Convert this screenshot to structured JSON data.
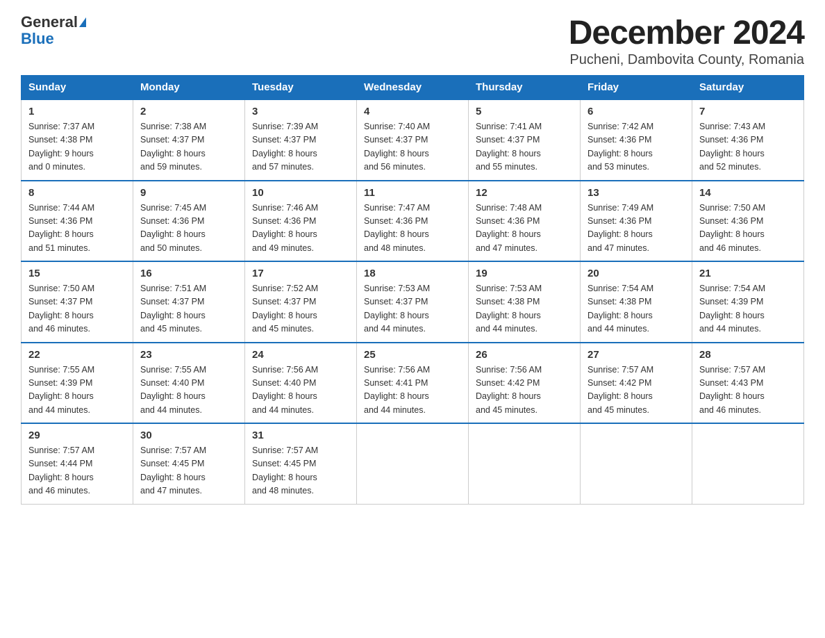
{
  "header": {
    "logo_general": "General",
    "logo_blue": "Blue",
    "title": "December 2024",
    "subtitle": "Pucheni, Dambovita County, Romania"
  },
  "days_of_week": [
    "Sunday",
    "Monday",
    "Tuesday",
    "Wednesday",
    "Thursday",
    "Friday",
    "Saturday"
  ],
  "weeks": [
    [
      {
        "num": "1",
        "sunrise": "7:37 AM",
        "sunset": "4:38 PM",
        "daylight": "9 hours and 0 minutes."
      },
      {
        "num": "2",
        "sunrise": "7:38 AM",
        "sunset": "4:37 PM",
        "daylight": "8 hours and 59 minutes."
      },
      {
        "num": "3",
        "sunrise": "7:39 AM",
        "sunset": "4:37 PM",
        "daylight": "8 hours and 57 minutes."
      },
      {
        "num": "4",
        "sunrise": "7:40 AM",
        "sunset": "4:37 PM",
        "daylight": "8 hours and 56 minutes."
      },
      {
        "num": "5",
        "sunrise": "7:41 AM",
        "sunset": "4:37 PM",
        "daylight": "8 hours and 55 minutes."
      },
      {
        "num": "6",
        "sunrise": "7:42 AM",
        "sunset": "4:36 PM",
        "daylight": "8 hours and 53 minutes."
      },
      {
        "num": "7",
        "sunrise": "7:43 AM",
        "sunset": "4:36 PM",
        "daylight": "8 hours and 52 minutes."
      }
    ],
    [
      {
        "num": "8",
        "sunrise": "7:44 AM",
        "sunset": "4:36 PM",
        "daylight": "8 hours and 51 minutes."
      },
      {
        "num": "9",
        "sunrise": "7:45 AM",
        "sunset": "4:36 PM",
        "daylight": "8 hours and 50 minutes."
      },
      {
        "num": "10",
        "sunrise": "7:46 AM",
        "sunset": "4:36 PM",
        "daylight": "8 hours and 49 minutes."
      },
      {
        "num": "11",
        "sunrise": "7:47 AM",
        "sunset": "4:36 PM",
        "daylight": "8 hours and 48 minutes."
      },
      {
        "num": "12",
        "sunrise": "7:48 AM",
        "sunset": "4:36 PM",
        "daylight": "8 hours and 47 minutes."
      },
      {
        "num": "13",
        "sunrise": "7:49 AM",
        "sunset": "4:36 PM",
        "daylight": "8 hours and 47 minutes."
      },
      {
        "num": "14",
        "sunrise": "7:50 AM",
        "sunset": "4:36 PM",
        "daylight": "8 hours and 46 minutes."
      }
    ],
    [
      {
        "num": "15",
        "sunrise": "7:50 AM",
        "sunset": "4:37 PM",
        "daylight": "8 hours and 46 minutes."
      },
      {
        "num": "16",
        "sunrise": "7:51 AM",
        "sunset": "4:37 PM",
        "daylight": "8 hours and 45 minutes."
      },
      {
        "num": "17",
        "sunrise": "7:52 AM",
        "sunset": "4:37 PM",
        "daylight": "8 hours and 45 minutes."
      },
      {
        "num": "18",
        "sunrise": "7:53 AM",
        "sunset": "4:37 PM",
        "daylight": "8 hours and 44 minutes."
      },
      {
        "num": "19",
        "sunrise": "7:53 AM",
        "sunset": "4:38 PM",
        "daylight": "8 hours and 44 minutes."
      },
      {
        "num": "20",
        "sunrise": "7:54 AM",
        "sunset": "4:38 PM",
        "daylight": "8 hours and 44 minutes."
      },
      {
        "num": "21",
        "sunrise": "7:54 AM",
        "sunset": "4:39 PM",
        "daylight": "8 hours and 44 minutes."
      }
    ],
    [
      {
        "num": "22",
        "sunrise": "7:55 AM",
        "sunset": "4:39 PM",
        "daylight": "8 hours and 44 minutes."
      },
      {
        "num": "23",
        "sunrise": "7:55 AM",
        "sunset": "4:40 PM",
        "daylight": "8 hours and 44 minutes."
      },
      {
        "num": "24",
        "sunrise": "7:56 AM",
        "sunset": "4:40 PM",
        "daylight": "8 hours and 44 minutes."
      },
      {
        "num": "25",
        "sunrise": "7:56 AM",
        "sunset": "4:41 PM",
        "daylight": "8 hours and 44 minutes."
      },
      {
        "num": "26",
        "sunrise": "7:56 AM",
        "sunset": "4:42 PM",
        "daylight": "8 hours and 45 minutes."
      },
      {
        "num": "27",
        "sunrise": "7:57 AM",
        "sunset": "4:42 PM",
        "daylight": "8 hours and 45 minutes."
      },
      {
        "num": "28",
        "sunrise": "7:57 AM",
        "sunset": "4:43 PM",
        "daylight": "8 hours and 46 minutes."
      }
    ],
    [
      {
        "num": "29",
        "sunrise": "7:57 AM",
        "sunset": "4:44 PM",
        "daylight": "8 hours and 46 minutes."
      },
      {
        "num": "30",
        "sunrise": "7:57 AM",
        "sunset": "4:45 PM",
        "daylight": "8 hours and 47 minutes."
      },
      {
        "num": "31",
        "sunrise": "7:57 AM",
        "sunset": "4:45 PM",
        "daylight": "8 hours and 48 minutes."
      },
      null,
      null,
      null,
      null
    ]
  ],
  "labels": {
    "sunrise": "Sunrise:",
    "sunset": "Sunset:",
    "daylight": "Daylight:"
  }
}
